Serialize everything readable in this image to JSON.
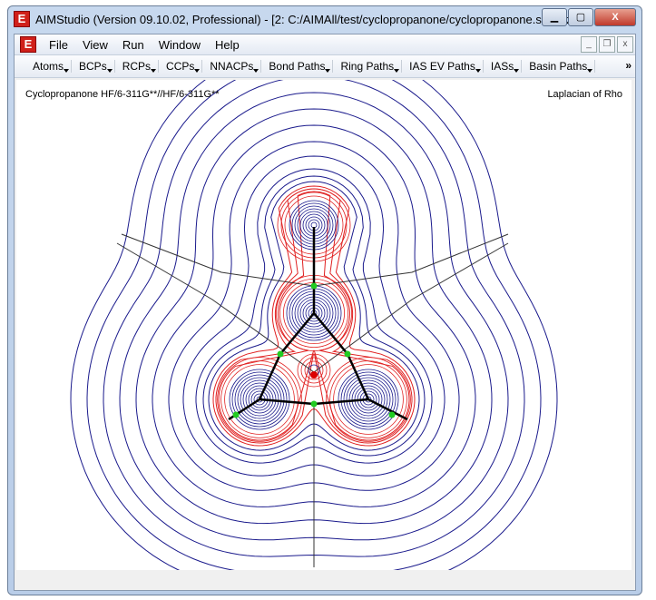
{
  "window": {
    "title": "AIMStudio (Version 09.10.02, Professional) - [2:  C:/AIMAll/test/cyclopropanone/cyclopropanone.sumviz]",
    "app_icon": "E"
  },
  "menu": [
    "File",
    "View",
    "Run",
    "Window",
    "Help"
  ],
  "toolbar": [
    "Atoms",
    "BCPs",
    "RCPs",
    "CCPs",
    "NNACPs",
    "Bond Paths",
    "Ring Paths",
    "IAS EV Paths",
    "IASs",
    "Basin Paths"
  ],
  "toolbar_more": "»",
  "canvas": {
    "left_label": "Cyclopropanone HF/6-311G**//HF/6-311G**",
    "right_label": "Laplacian of Rho"
  },
  "colors": {
    "positive_contour": "#1a1a8c",
    "negative_contour": "#e02020",
    "bcp": "#22cc22",
    "rcp": "#dd0000",
    "bond_path": "#000000"
  }
}
